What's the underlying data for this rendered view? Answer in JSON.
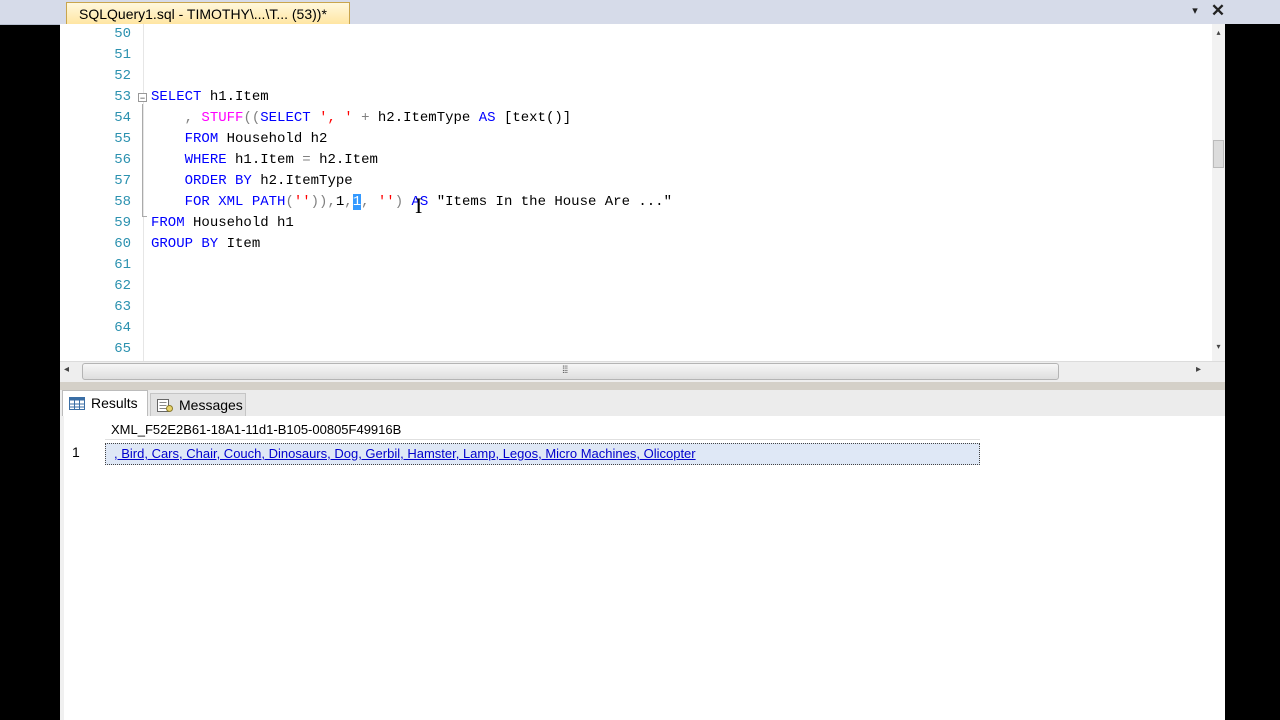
{
  "document_tab": {
    "title": "SQLQuery1.sql - TIMOTHY\\...\\T... (53))*",
    "dropdown_glyph": "▾",
    "close_glyph": "✕"
  },
  "editor": {
    "line_numbers": [
      "50",
      "51",
      "52",
      "53",
      "54",
      "55",
      "56",
      "57",
      "58",
      "59",
      "60",
      "61",
      "62",
      "63",
      "64",
      "65"
    ],
    "fold_glyph": "−"
  },
  "scroll": {
    "grip": "⁞⁞⁞",
    "left": "◂",
    "right": "▸",
    "up": "▴",
    "down": "▾"
  },
  "results_tabs": {
    "results_label": "Results",
    "messages_label": "Messages"
  },
  "results_grid": {
    "column_header": "XML_F52E2B61-18A1-11d1-B105-00805F49916B",
    "rows": [
      {
        "row_number": "1",
        "value": ", Bird, Cars, Chair, Couch, Dinosaurs, Dog, Gerbil, Hamster, Lamp, Legos, Micro Machines, Olicopter"
      }
    ]
  },
  "colors": {
    "keyword": "#0000ff",
    "function": "#ff00ff",
    "string": "#ff0000",
    "operator": "#808080",
    "line_number": "#2b91af",
    "selection": "#3399ff"
  }
}
